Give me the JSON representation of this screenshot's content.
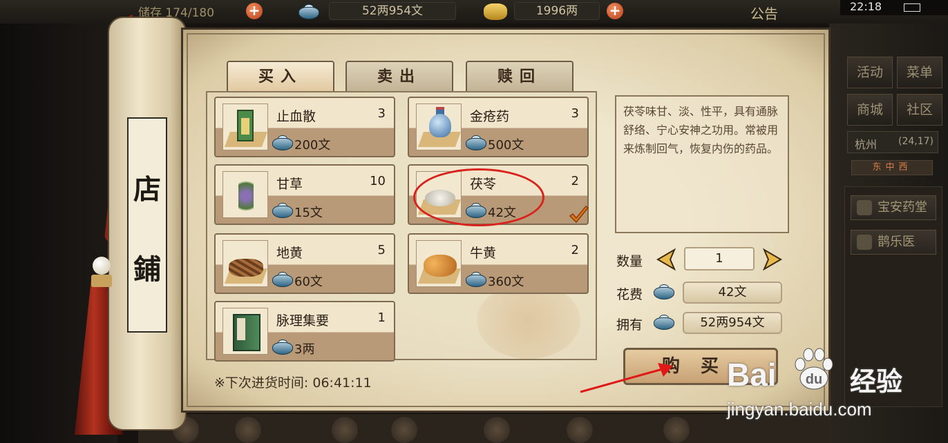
{
  "status_bar": {
    "backpack_text": "储存 174/180",
    "silver_display": "52两954文",
    "gold_display": "1996两",
    "announcement_label": "公告",
    "time": "22:18"
  },
  "side_menu": {
    "activity_label": "活动",
    "menu_label": "菜单",
    "mall_label": "商城",
    "community_label": "社区",
    "location_city": "杭州",
    "location_coords": "(24,17)",
    "compass_text": "东中西",
    "npcs": [
      "宝安药堂",
      "鹊乐医"
    ]
  },
  "scroll": {
    "title_char_1": "店",
    "title_char_2": "鋪"
  },
  "tabs": [
    {
      "label": "买入"
    },
    {
      "label": "卖出"
    },
    {
      "label": "赎回"
    }
  ],
  "goods": [
    {
      "name": "止血散",
      "qty": "3",
      "price": "200文",
      "icon": "medicine-bottle-icon"
    },
    {
      "name": "金疮药",
      "qty": "3",
      "price": "500文",
      "icon": "blue-vase-icon"
    },
    {
      "name": "甘草",
      "qty": "10",
      "price": "15文",
      "icon": "herb-icon"
    },
    {
      "name": "茯苓",
      "qty": "2",
      "price": "42文",
      "icon": "white-pile-icon"
    },
    {
      "name": "地黄",
      "qty": "5",
      "price": "60文",
      "icon": "root-icon"
    },
    {
      "name": "牛黄",
      "qty": "2",
      "price": "360文",
      "icon": "nugget-icon"
    },
    {
      "name": "脉理集要",
      "qty": "1",
      "price": "3两",
      "icon": "book-icon"
    }
  ],
  "selected_item": "茯苓",
  "description": "茯苓味甘、淡、性平，具有通脉舒络、宁心安神之功用。常被用来炼制回气，恢复内伤的药品。",
  "purchase": {
    "qty_label": "数量",
    "qty_value": "1",
    "cost_label": "花费",
    "cost_value": "42文",
    "owned_label": "拥有",
    "owned_value": "52两954文",
    "buy_label": "购买"
  },
  "restock_text": "※下次进货时间: 06:41:11",
  "watermark": {
    "brand": "Bai",
    "brand_suffix": "经验",
    "url": "jingyan.baidu.com"
  },
  "colors": {
    "parchment": "#efe6cd",
    "highlight": "#d9231e",
    "checkmark": "#e07818",
    "accent_red": "#8a2418"
  }
}
